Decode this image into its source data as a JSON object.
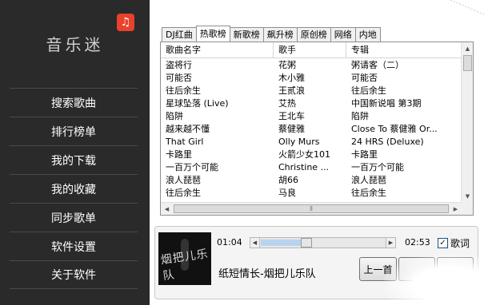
{
  "app": {
    "title": "音乐迷",
    "logo_icon": "music-note-icon",
    "logo_color": "#e8412c"
  },
  "sidebar": {
    "items": [
      {
        "label": "搜索歌曲"
      },
      {
        "label": "排行榜单"
      },
      {
        "label": "我的下载"
      },
      {
        "label": "我的收藏"
      },
      {
        "label": "同步歌单"
      },
      {
        "label": "软件设置"
      },
      {
        "label": "关于软件"
      }
    ]
  },
  "tabs": [
    {
      "label": "DJ红曲"
    },
    {
      "label": "热歌榜",
      "active": true
    },
    {
      "label": "新歌榜"
    },
    {
      "label": "飙升榜"
    },
    {
      "label": "原创榜"
    },
    {
      "label": "网络"
    },
    {
      "label": "内地"
    }
  ],
  "table": {
    "columns": [
      "歌曲名字",
      "歌手",
      "专辑"
    ],
    "rows": [
      [
        "盗将行",
        "花粥",
        "粥请客（二）"
      ],
      [
        "可能否",
        "木小雅",
        "可能否"
      ],
      [
        "往后余生",
        "王贰浪",
        "往后余生"
      ],
      [
        "星球坠落 (Live)",
        "艾热",
        "中国新说唱 第3期"
      ],
      [
        "陷阱",
        "王北车",
        "陷阱"
      ],
      [
        "越来越不懂",
        "蔡健雅",
        "Close To 蔡健雅 Or..."
      ],
      [
        "That Girl",
        "Olly Murs",
        "24 HRS (Deluxe)"
      ],
      [
        "卡路里",
        "火箭少女101",
        "卡路里"
      ],
      [
        "一百万个可能",
        "Christine ...",
        "一百万个可能"
      ],
      [
        "浪人琵琶",
        "胡66",
        "浪人琵琶"
      ],
      [
        "往后余生",
        "马良",
        "往后余生"
      ]
    ]
  },
  "player": {
    "current_time": "01:04",
    "total_time": "02:53",
    "progress": 0.37,
    "lyric_label": "歌词",
    "lyric_checked": true,
    "song_title": "纸短情长-烟把儿乐队",
    "cover_text": "烟把儿乐队",
    "prev_label": "上一首"
  }
}
